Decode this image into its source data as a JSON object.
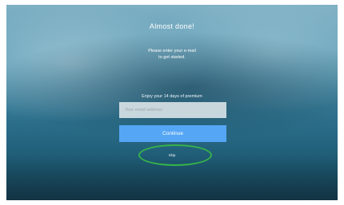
{
  "screen": {
    "title": "Almost done!",
    "subtitle_line1": "Please enter your e-mail",
    "subtitle_line2": "to get started.",
    "premium_text": "Enjoy your 14 days of premium",
    "email_input": {
      "value": "",
      "placeholder": "Your email address"
    },
    "continue_label": "Continue",
    "skip_label": "Skip"
  },
  "colors": {
    "button": "#55a6f5",
    "highlight": "#36b24a"
  }
}
